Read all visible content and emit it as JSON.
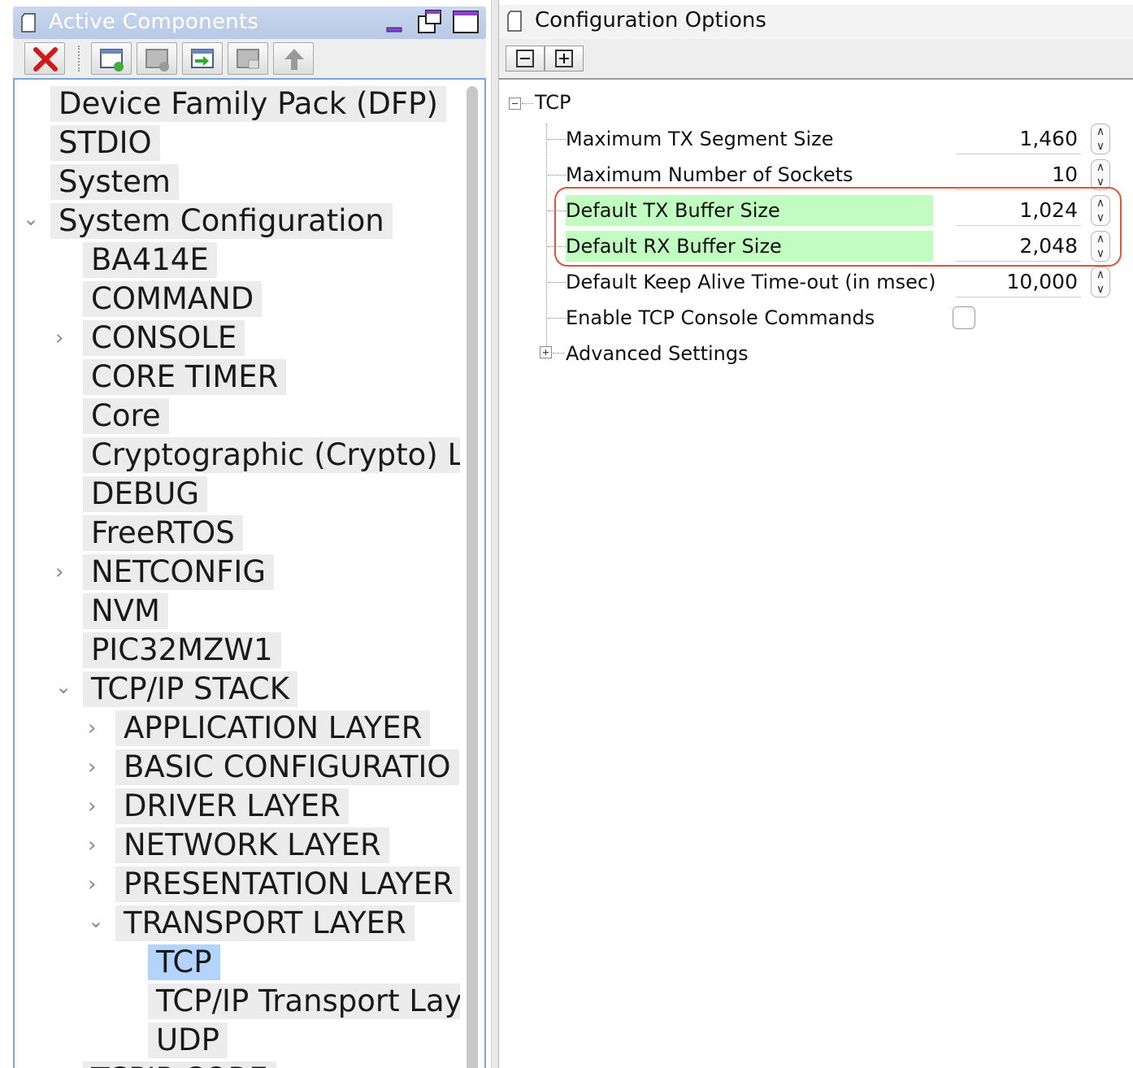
{
  "left": {
    "title": "Active Components",
    "tree": [
      {
        "label": "Device Family Pack (DFP)",
        "depth": 0,
        "arrow": ""
      },
      {
        "label": "STDIO",
        "depth": 0,
        "arrow": ""
      },
      {
        "label": "System",
        "depth": 0,
        "arrow": ""
      },
      {
        "label": "System Configuration",
        "depth": 0,
        "arrow": "expanded"
      },
      {
        "label": "BA414E",
        "depth": 1,
        "arrow": ""
      },
      {
        "label": "COMMAND",
        "depth": 1,
        "arrow": ""
      },
      {
        "label": "CONSOLE",
        "depth": 1,
        "arrow": "collapsed"
      },
      {
        "label": "CORE TIMER",
        "depth": 1,
        "arrow": ""
      },
      {
        "label": "Core",
        "depth": 1,
        "arrow": ""
      },
      {
        "label": "Cryptographic (Crypto) L",
        "depth": 1,
        "arrow": ""
      },
      {
        "label": "DEBUG",
        "depth": 1,
        "arrow": ""
      },
      {
        "label": "FreeRTOS",
        "depth": 1,
        "arrow": ""
      },
      {
        "label": "NETCONFIG",
        "depth": 1,
        "arrow": "collapsed"
      },
      {
        "label": "NVM",
        "depth": 1,
        "arrow": ""
      },
      {
        "label": "PIC32MZW1",
        "depth": 1,
        "arrow": ""
      },
      {
        "label": "TCP/IP STACK",
        "depth": 1,
        "arrow": "expanded"
      },
      {
        "label": "APPLICATION LAYER",
        "depth": 2,
        "arrow": "collapsed"
      },
      {
        "label": "BASIC CONFIGURATIO",
        "depth": 2,
        "arrow": "collapsed"
      },
      {
        "label": "DRIVER LAYER",
        "depth": 2,
        "arrow": "collapsed"
      },
      {
        "label": "NETWORK LAYER",
        "depth": 2,
        "arrow": "collapsed"
      },
      {
        "label": "PRESENTATION LAYER",
        "depth": 2,
        "arrow": "collapsed"
      },
      {
        "label": "TRANSPORT LAYER",
        "depth": 2,
        "arrow": "expanded"
      },
      {
        "label": "TCP",
        "depth": 3,
        "arrow": "",
        "selected": true
      },
      {
        "label": "TCP/IP Transport Lay",
        "depth": 3,
        "arrow": ""
      },
      {
        "label": "UDP",
        "depth": 3,
        "arrow": ""
      },
      {
        "label": "TCPIP CORE",
        "depth": 1,
        "arrow": ""
      }
    ],
    "toolbar_icons": [
      "remove-component-icon",
      "new-component-icon",
      "remove-dependency-icon",
      "activate-component-icon",
      "disable-component-icon",
      "move-up-icon"
    ],
    "title_icons": [
      "minimize-icon",
      "float-icon",
      "maximize-icon"
    ]
  },
  "right": {
    "title": "Configuration Options",
    "root_label": "TCP",
    "options": [
      {
        "label": "Maximum TX Segment Size",
        "type": "number",
        "value": "1,460",
        "highlight": false
      },
      {
        "label": "Maximum Number of Sockets",
        "type": "number",
        "value": "10",
        "highlight": false
      },
      {
        "label": "Default TX Buffer Size",
        "type": "number",
        "value": "1,024",
        "highlight": true
      },
      {
        "label": "Default RX Buffer Size",
        "type": "number",
        "value": "2,048",
        "highlight": true
      },
      {
        "label": "Default Keep Alive Time-out (in msec)",
        "type": "number",
        "value": "10,000",
        "highlight": false
      },
      {
        "label": "Enable TCP Console Commands",
        "type": "checkbox",
        "value": "",
        "checked": false,
        "highlight": false
      }
    ],
    "advanced_label": "Advanced Settings"
  },
  "colors": {
    "highlight_green": "#c1fcc0",
    "selection_blue": "#b3d4ff",
    "annotation_red": "#e0513e",
    "title_bar_blue": "#b7c9e6"
  }
}
